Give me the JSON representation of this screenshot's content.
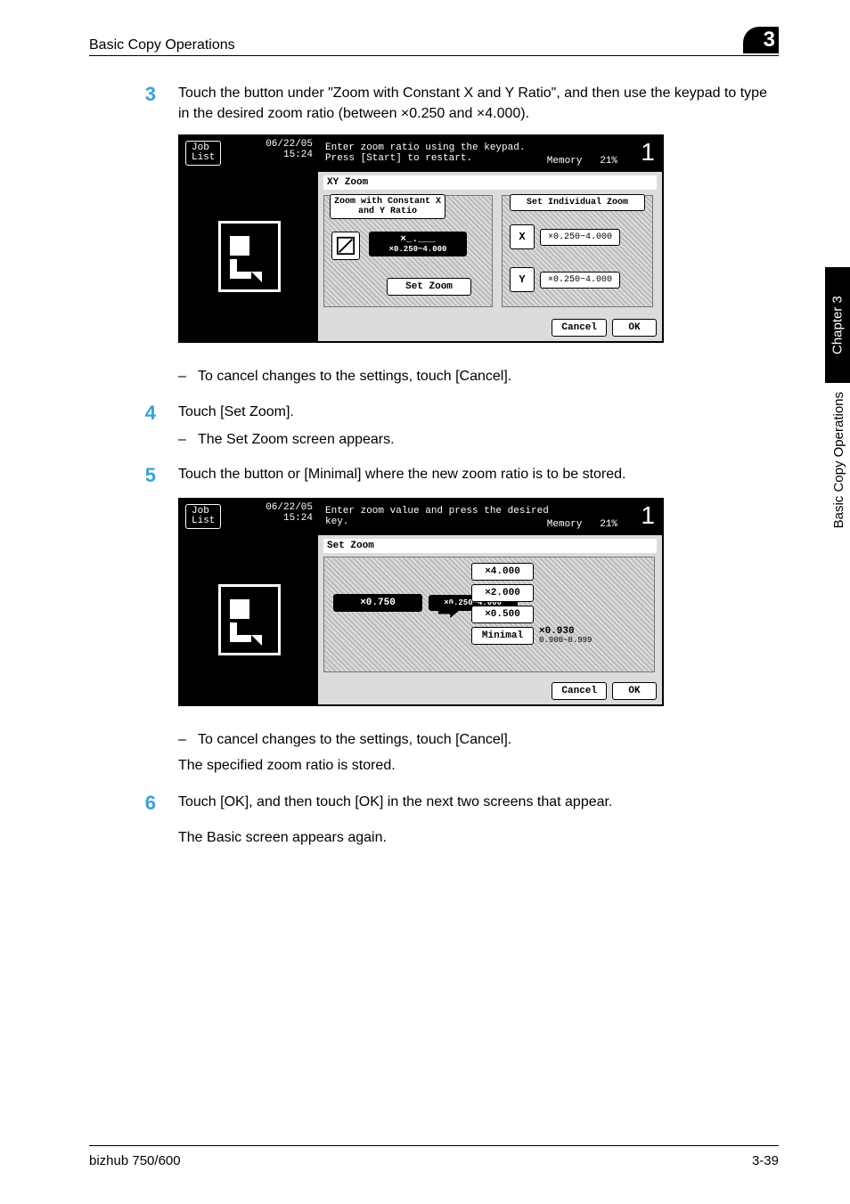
{
  "header": {
    "title": "Basic Copy Operations",
    "chapter_badge": "3"
  },
  "side": {
    "tab": "Chapter 3",
    "text": "Basic Copy Operations"
  },
  "steps": {
    "s3": {
      "num": "3",
      "body": "Touch the button under \"Zoom with Constant X and Y Ratio\", and then use the keypad to type in the desired zoom ratio (between ×0.250 and ×4.000).",
      "sub": "To cancel changes to the settings, touch [Cancel]."
    },
    "s4": {
      "num": "4",
      "body": "Touch [Set Zoom].",
      "sub": "The Set Zoom screen appears."
    },
    "s5": {
      "num": "5",
      "body": "Touch the button or [Minimal] where the new zoom ratio is to be stored.",
      "sub": "To cancel changes to the settings, touch [Cancel].",
      "plain": "The specified zoom ratio is stored."
    },
    "s6": {
      "num": "6",
      "body": "Touch [OK], and then touch [OK] in the next two screens that appear.",
      "plain": "The Basic screen appears again."
    }
  },
  "shot1": {
    "joblist": "Job\nList",
    "date": "06/22/05",
    "time": "15:24",
    "msg": "Enter zoom ratio using the keypad.\nPress [Start] to restart.",
    "memory": "Memory",
    "mempct": "21%",
    "count": "1",
    "title": "XY Zoom",
    "tab_left": "Zoom with Constant X\nand Y Ratio",
    "tab_right": "Set Individual Zoom",
    "inputval": "×_.___",
    "range": "×0.250~4.000",
    "setzoom": "Set Zoom",
    "xlabel": "X",
    "xrange": "×0.250~4.000",
    "ylabel": "Y",
    "yrange": "×0.250~4.000",
    "cancel": "Cancel",
    "ok": "OK"
  },
  "shot2": {
    "joblist": "Job\nList",
    "date": "06/22/05",
    "time": "15:24",
    "msg": "Enter zoom value and press the desired\nkey.",
    "memory": "Memory",
    "mempct": "21%",
    "count": "1",
    "title": "Set Zoom",
    "current": "×0.750",
    "range": "×0.250~4.000",
    "p1": "×4.000",
    "p2": "×2.000",
    "p3": "×0.500",
    "minimal": "Minimal",
    "minval": "×0.930",
    "minrange": "0.900~0.999",
    "cancel": "Cancel",
    "ok": "OK"
  },
  "footer": {
    "left": "bizhub 750/600",
    "right": "3-39"
  }
}
